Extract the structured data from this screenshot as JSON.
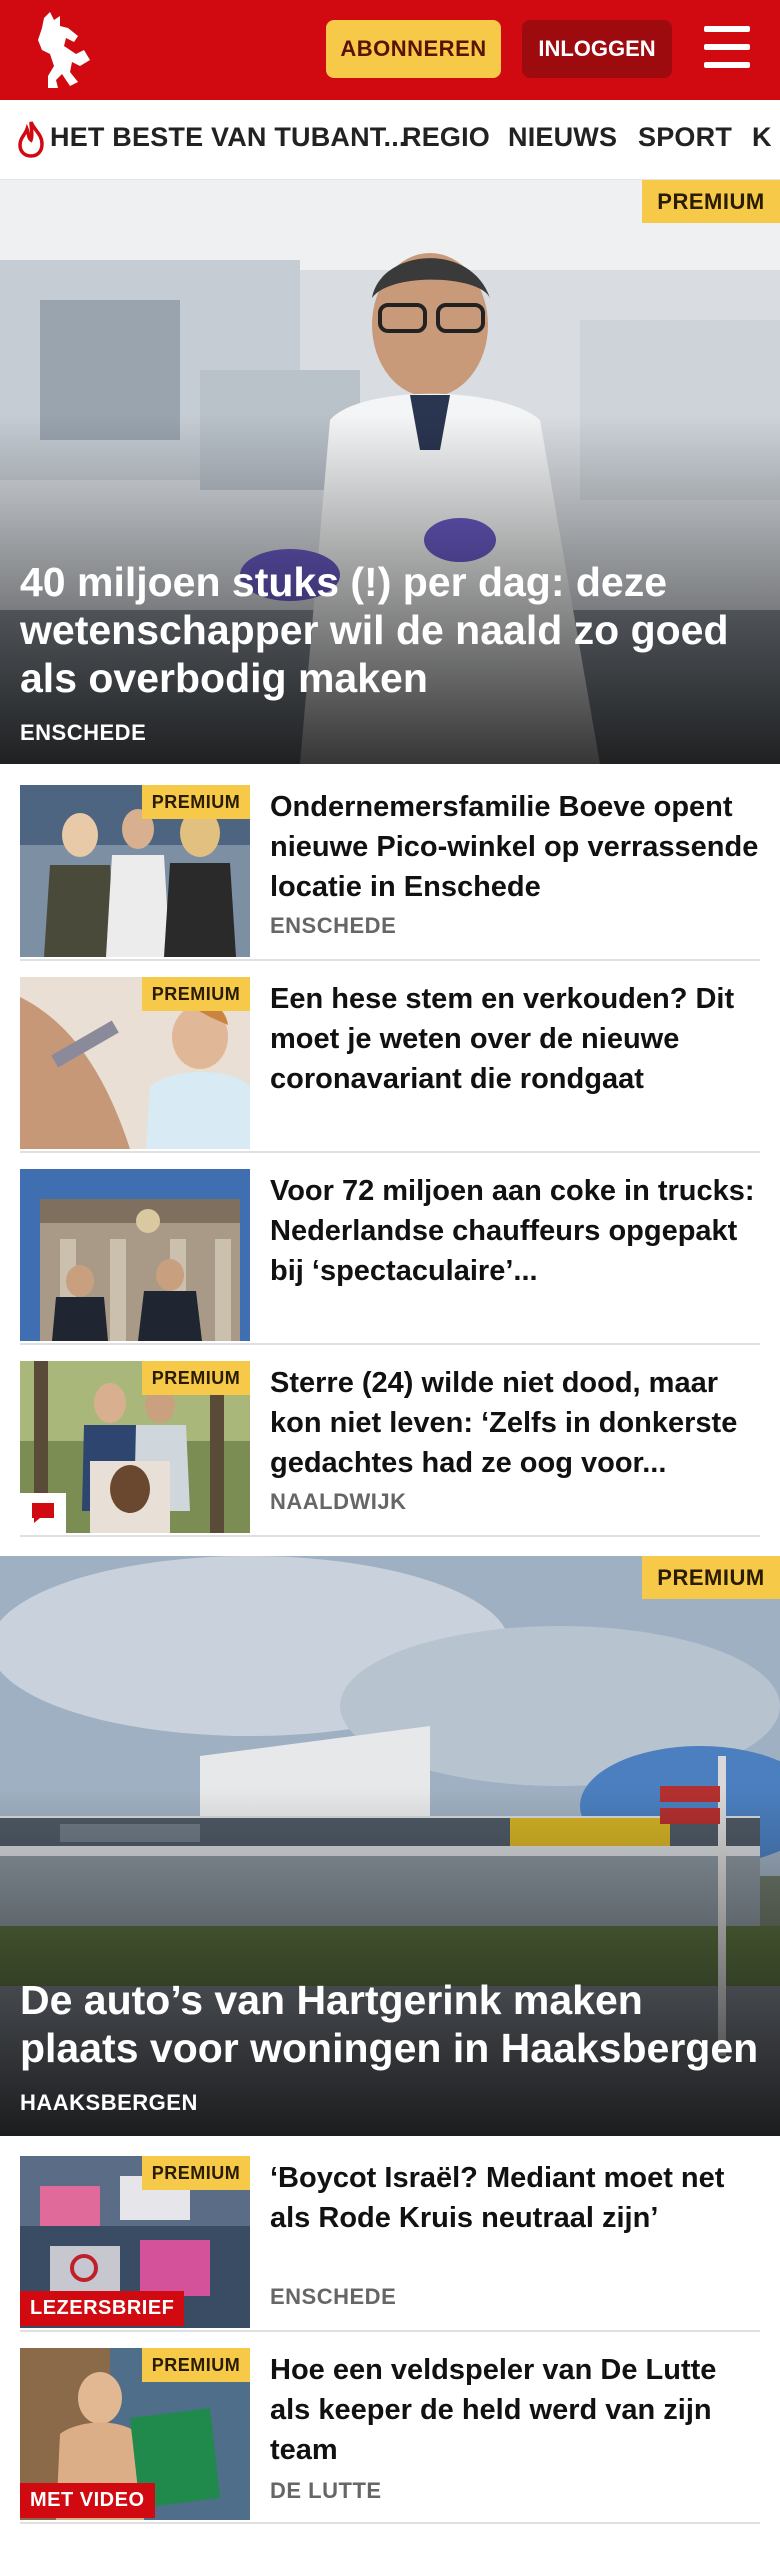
{
  "header": {
    "subscribe_label": "ABONNEREN",
    "login_label": "INLOGGEN",
    "brand_color": "#d10a11",
    "logo_icon": "tubantia-horse-icon",
    "menu_icon": "hamburger-menu-icon"
  },
  "nav": {
    "items": [
      "HET BESTE VAN TUBANT...",
      "REGIO",
      "NIEUWS",
      "SPORT",
      "K"
    ]
  },
  "articles": {
    "hero1": {
      "title": "40 miljoen stuks (!) per dag: deze wetenschapper wil de naald zo goed als overbodig maken",
      "tag": "ENSCHEDE",
      "premium": "PREMIUM"
    },
    "a1": {
      "title": "Ondernemersfamilie Boeve opent nieuwe Pico-winkel op verrassende locatie in Enschede",
      "tag": "ENSCHEDE",
      "premium": "PREMIUM"
    },
    "a2": {
      "title": "Een hese stem en verkouden? Dit moet je weten over de nieuwe coronavariant die rondgaat",
      "premium": "PREMIUM"
    },
    "a3": {
      "title": "Voor 72 miljoen aan coke in trucks: Nederlandse chauffeurs opgepakt bij ‘spectaculaire’..."
    },
    "a4": {
      "title": "Sterre (24) wilde niet dood, maar kon niet leven: ‘Zelfs in donkerste gedachtes had ze oog voor...",
      "tag": "NAALDWIJK",
      "premium": "PREMIUM"
    },
    "hero2": {
      "title": "De auto’s van Hartgerink maken plaats voor woningen in Haaksbergen",
      "tag": "HAAKSBERGEN",
      "premium": "PREMIUM"
    },
    "a5": {
      "title": "‘Boycot Israël? Mediant moet net als Rode Kruis neutraal zijn’",
      "tag": "ENSCHEDE",
      "premium": "PREMIUM",
      "label": "LEZERSBRIEF"
    },
    "a6": {
      "title": "Hoe een veldspeler van De Lutte als keeper de held werd van zijn team",
      "tag": "DE LUTTE",
      "premium": "PREMIUM",
      "label": "MET VIDEO"
    }
  },
  "colors": {
    "premium": "#f7c948",
    "label_red": "#d10a11"
  }
}
